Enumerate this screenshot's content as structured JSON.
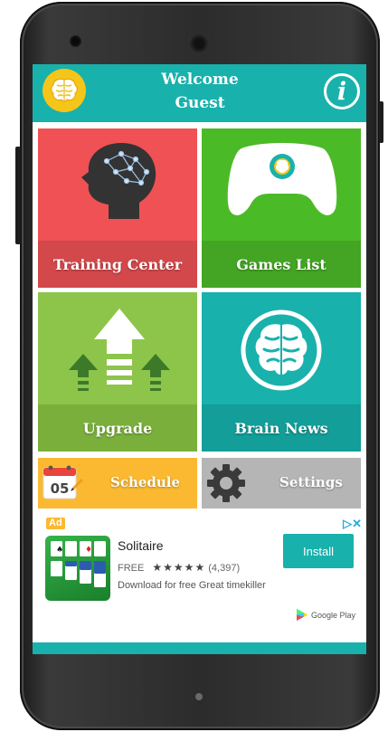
{
  "header": {
    "line1": "Welcome",
    "line2": "Guest",
    "logo_icon": "brain-logo-icon",
    "info_icon": "info-icon",
    "info_glyph": "i",
    "accent": "#19b1ac"
  },
  "tiles": [
    {
      "label": "Training Center",
      "icon": "head-brain-icon",
      "color": "#f05154"
    },
    {
      "label": "Games List",
      "icon": "gamepad-icon",
      "color": "#4bba27"
    },
    {
      "label": "Upgrade",
      "icon": "upgrade-arrows-icon",
      "color": "#8dc54a"
    },
    {
      "label": "Brain News",
      "icon": "brain-circle-icon",
      "color": "#19b1ac"
    }
  ],
  "strips": [
    {
      "label": "Schedule",
      "icon": "calendar-icon",
      "calendar_day": "05",
      "color": "#fbb931"
    },
    {
      "label": "Settings",
      "icon": "gear-icon",
      "color": "#b5b5b5"
    }
  ],
  "ad": {
    "badge": "Ad",
    "title": "Solitaire",
    "price": "FREE",
    "stars": "★★★★★",
    "rating_count": "(4,397)",
    "description": "Download for free Great timekiller",
    "install_label": "Install",
    "store_label": "Google Play",
    "choices_glyph": "▷✕"
  }
}
